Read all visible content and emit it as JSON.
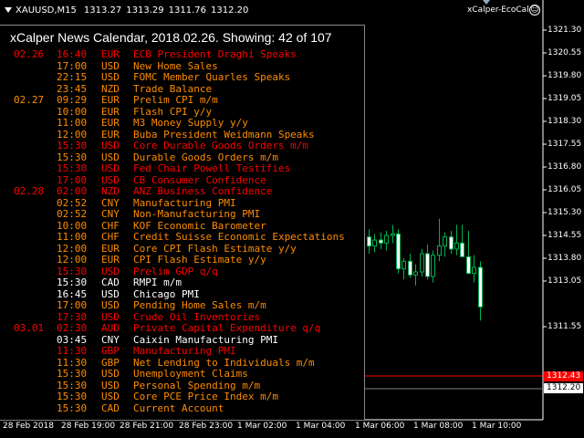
{
  "header": {
    "symbol": "XAUUSD,M15",
    "open": "1313.27",
    "high": "1313.29",
    "low": "1311.76",
    "close": "1312.20"
  },
  "expert": {
    "name": "xCalper-EcoCal",
    "smiley": "☺"
  },
  "calendar": {
    "title": "xCalper News Calendar, 2018.02.26. Showing: 42 of 107",
    "high_impact_color": "#ff0000",
    "medium_impact_color": "#ff8c00",
    "low_impact_color": "#ffffff",
    "events": [
      {
        "date": "02.26",
        "time": "16:40",
        "cur": "EUR",
        "name": "ECB President Draghi Speaks",
        "impact": "high"
      },
      {
        "date": "",
        "time": "17:00",
        "cur": "USD",
        "name": "New Home Sales",
        "impact": "medium"
      },
      {
        "date": "",
        "time": "22:15",
        "cur": "USD",
        "name": "FOMC Member Quarles Speaks",
        "impact": "medium"
      },
      {
        "date": "",
        "time": "23:45",
        "cur": "NZD",
        "name": "Trade Balance",
        "impact": "medium"
      },
      {
        "date": "02.27",
        "time": "09:29",
        "cur": "EUR",
        "name": "Prelim CPI m/m",
        "impact": "medium"
      },
      {
        "date": "",
        "time": "10:00",
        "cur": "EUR",
        "name": "Flash CPI y/y",
        "impact": "medium"
      },
      {
        "date": "",
        "time": "11:00",
        "cur": "EUR",
        "name": "M3 Money Supply y/y",
        "impact": "medium"
      },
      {
        "date": "",
        "time": "12:00",
        "cur": "EUR",
        "name": "Buba President Weidmann Speaks",
        "impact": "medium"
      },
      {
        "date": "",
        "time": "15:30",
        "cur": "USD",
        "name": "Core Durable Goods Orders m/m",
        "impact": "high"
      },
      {
        "date": "",
        "time": "15:30",
        "cur": "USD",
        "name": "Durable Goods Orders m/m",
        "impact": "medium"
      },
      {
        "date": "",
        "time": "15:30",
        "cur": "USD",
        "name": "Fed Chair Powell Testifies",
        "impact": "high"
      },
      {
        "date": "",
        "time": "17:00",
        "cur": "USD",
        "name": "CB Consumer Confidence",
        "impact": "high"
      },
      {
        "date": "02.28",
        "time": "02:00",
        "cur": "NZD",
        "name": "ANZ Business Confidence",
        "impact": "high"
      },
      {
        "date": "",
        "time": "02:52",
        "cur": "CNY",
        "name": "Manufacturing PMI",
        "impact": "medium"
      },
      {
        "date": "",
        "time": "02:52",
        "cur": "CNY",
        "name": "Non-Manufacturing PMI",
        "impact": "medium"
      },
      {
        "date": "",
        "time": "10:00",
        "cur": "CHF",
        "name": "KOF Economic Barometer",
        "impact": "medium"
      },
      {
        "date": "",
        "time": "11:00",
        "cur": "CHF",
        "name": "Credit Suisse Economic Expectations",
        "impact": "medium"
      },
      {
        "date": "",
        "time": "12:00",
        "cur": "EUR",
        "name": "Core CPI Flash Estimate y/y",
        "impact": "medium"
      },
      {
        "date": "",
        "time": "12:00",
        "cur": "EUR",
        "name": "CPI Flash Estimate y/y",
        "impact": "medium"
      },
      {
        "date": "",
        "time": "15:30",
        "cur": "USD",
        "name": "Prelim GDP q/q",
        "impact": "high"
      },
      {
        "date": "",
        "time": "15:30",
        "cur": "CAD",
        "name": "RMPI m/m",
        "impact": "low"
      },
      {
        "date": "",
        "time": "16:45",
        "cur": "USD",
        "name": "Chicago PMI",
        "impact": "low"
      },
      {
        "date": "",
        "time": "17:00",
        "cur": "USD",
        "name": "Pending Home Sales m/m",
        "impact": "medium"
      },
      {
        "date": "",
        "time": "17:30",
        "cur": "USD",
        "name": "Crude Oil Inventories",
        "impact": "high"
      },
      {
        "date": "03.01",
        "time": "02:30",
        "cur": "AUD",
        "name": "Private Capital Expenditure q/q",
        "impact": "high"
      },
      {
        "date": "",
        "time": "03:45",
        "cur": "CNY",
        "name": "Caixin Manufacturing PMI",
        "impact": "low"
      },
      {
        "date": "",
        "time": "11:30",
        "cur": "GBP",
        "name": "Manufacturing PMI",
        "impact": "high"
      },
      {
        "date": "",
        "time": "11:30",
        "cur": "GBP",
        "name": "Net Lending to Individuals m/m",
        "impact": "medium"
      },
      {
        "date": "",
        "time": "15:30",
        "cur": "USD",
        "name": "Unemployment Claims",
        "impact": "medium"
      },
      {
        "date": "",
        "time": "15:30",
        "cur": "USD",
        "name": "Personal Spending m/m",
        "impact": "medium"
      },
      {
        "date": "",
        "time": "15:30",
        "cur": "USD",
        "name": "Core PCE Price Index m/m",
        "impact": "medium"
      },
      {
        "date": "",
        "time": "15:30",
        "cur": "CAD",
        "name": "Current Account",
        "impact": "medium"
      }
    ]
  },
  "price_axis": {
    "labels": [
      "1321.30",
      "1320.55",
      "1319.80",
      "1319.05",
      "1318.30",
      "1317.55",
      "1316.80",
      "1316.05",
      "1315.30",
      "1314.55",
      "1313.80",
      "1313.05",
      "1311.55"
    ],
    "ask_tag": "1312.43",
    "bid_tag": "1312.20",
    "ask_color": "#ff0000",
    "bid_color": "#c0c0c0"
  },
  "time_axis": {
    "labels": [
      "28 Feb 2018",
      "28 Feb 19:00",
      "28 Feb 21:00",
      "28 Feb 23:00",
      "1 Mar 02:00",
      "1 Mar 04:00",
      "1 Mar 06:00",
      "1 Mar 08:00",
      "1 Mar 10:00"
    ]
  },
  "candles": [
    {
      "o": 1314.5,
      "h": 1314.75,
      "l": 1313.95,
      "c": 1314.2
    },
    {
      "o": 1314.2,
      "h": 1314.6,
      "l": 1314.0,
      "c": 1314.4
    },
    {
      "o": 1314.4,
      "h": 1314.65,
      "l": 1314.1,
      "c": 1314.3
    },
    {
      "o": 1314.3,
      "h": 1314.7,
      "l": 1314.05,
      "c": 1314.55
    },
    {
      "o": 1314.55,
      "h": 1314.9,
      "l": 1314.3,
      "c": 1314.6
    },
    {
      "o": 1314.6,
      "h": 1314.75,
      "l": 1313.3,
      "c": 1313.45
    },
    {
      "o": 1313.45,
      "h": 1313.8,
      "l": 1313.1,
      "c": 1313.7
    },
    {
      "o": 1313.7,
      "h": 1313.95,
      "l": 1313.15,
      "c": 1313.25
    },
    {
      "o": 1313.25,
      "h": 1313.6,
      "l": 1312.9,
      "c": 1313.35
    },
    {
      "o": 1313.35,
      "h": 1314.1,
      "l": 1313.2,
      "c": 1313.95
    },
    {
      "o": 1313.95,
      "h": 1314.25,
      "l": 1313.1,
      "c": 1313.2
    },
    {
      "o": 1313.2,
      "h": 1314.05,
      "l": 1313.0,
      "c": 1313.9
    },
    {
      "o": 1313.9,
      "h": 1315.1,
      "l": 1313.7,
      "c": 1314.2
    },
    {
      "o": 1314.2,
      "h": 1314.65,
      "l": 1313.85,
      "c": 1314.5
    },
    {
      "o": 1314.5,
      "h": 1314.7,
      "l": 1313.95,
      "c": 1314.1
    },
    {
      "o": 1314.1,
      "h": 1314.9,
      "l": 1313.9,
      "c": 1314.3
    },
    {
      "o": 1314.3,
      "h": 1314.9,
      "l": 1314.1,
      "c": 1313.85
    },
    {
      "o": 1313.85,
      "h": 1314.7,
      "l": 1313.3,
      "c": 1313.3
    },
    {
      "o": 1313.3,
      "h": 1313.9,
      "l": 1313.0,
      "c": 1313.5
    },
    {
      "o": 1313.5,
      "h": 1313.7,
      "l": 1311.75,
      "c": 1312.2
    }
  ]
}
